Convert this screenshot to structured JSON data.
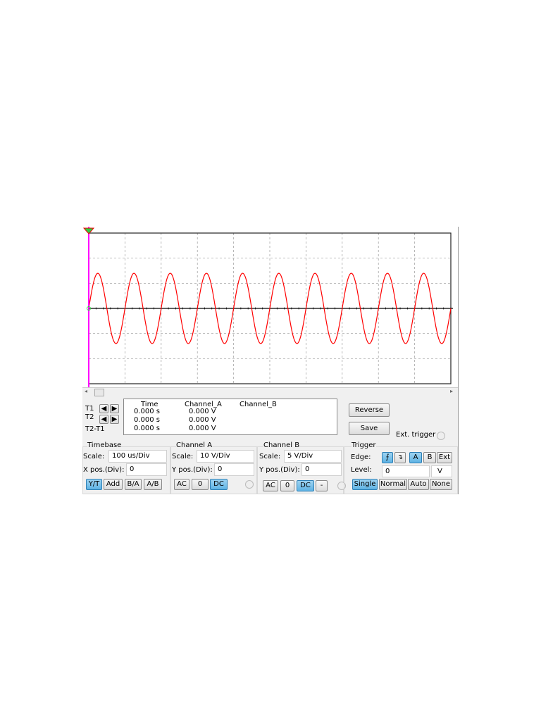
{
  "cursors": {
    "t1": "T1",
    "t2": "T2",
    "t2t1": "T2-T1"
  },
  "readout": {
    "headers": [
      "Time",
      "Channel_A",
      "Channel_B"
    ],
    "rows": [
      [
        "0.000 s",
        "0.000 V",
        ""
      ],
      [
        "0.000 s",
        "0.000 V",
        ""
      ],
      [
        "0.000 s",
        "0.000 V",
        ""
      ]
    ]
  },
  "buttons": {
    "reverse": "Reverse",
    "save": "Save",
    "ext_trigger": "Ext. trigger"
  },
  "timebase": {
    "title": "Timebase",
    "scale_label": "Scale:",
    "scale": "100 us/Div",
    "xpos_label": "X pos.(Div):",
    "xpos": "0",
    "modes": [
      "Y/T",
      "Add",
      "B/A",
      "A/B"
    ]
  },
  "channel_a": {
    "title": "Channel A",
    "scale_label": "Scale:",
    "scale": "10  V/Div",
    "ypos_label": "Y pos.(Div):",
    "ypos": "0",
    "coupling": [
      "AC",
      "0",
      "DC"
    ]
  },
  "channel_b": {
    "title": "Channel B",
    "scale_label": "Scale:",
    "scale": "5  V/Div",
    "ypos_label": "Y pos.(Div):",
    "ypos": "0",
    "coupling": [
      "AC",
      "0",
      "DC",
      "-"
    ]
  },
  "trigger": {
    "title": "Trigger",
    "edge_label": "Edge:",
    "edge_buttons": [
      "A",
      "B",
      "Ext"
    ],
    "level_label": "Level:",
    "level": "0",
    "level_unit": "V",
    "modes": [
      "Single",
      "Normal",
      "Auto",
      "None"
    ]
  },
  "chart_data": {
    "type": "line",
    "x_divisions": 10,
    "y_divisions": 6,
    "time_per_div_us": 100,
    "volts_per_div": 10,
    "series": [
      {
        "name": "Channel_A",
        "color": "#ff0000",
        "amplitude_V": 14,
        "frequency_kHz": 10,
        "phase_deg": 0
      }
    ]
  }
}
